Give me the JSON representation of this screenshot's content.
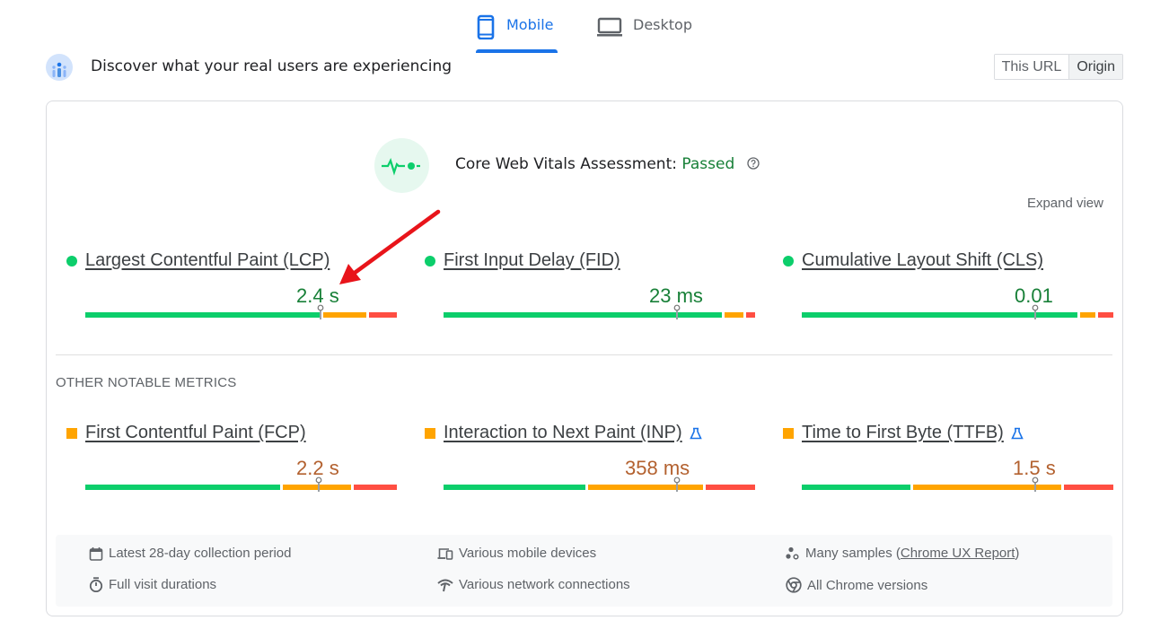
{
  "tabs": [
    {
      "label": "Mobile",
      "icon": "smartphone-icon",
      "active": true
    },
    {
      "label": "Desktop",
      "icon": "laptop-icon",
      "active": false
    }
  ],
  "header": {
    "title": "Discover what your real users are experiencing",
    "toggle": {
      "this_url": "This URL",
      "origin": "Origin",
      "selected": "Origin"
    }
  },
  "assessment": {
    "label": "Core Web Vitals Assessment:",
    "status": "Passed",
    "status_color": "#188038",
    "expand_label": "Expand view"
  },
  "core_metrics": [
    {
      "name": "Largest Contentful Paint (LCP)",
      "value": "2.4 s",
      "rating": "good",
      "distribution": {
        "good": 0.76,
        "needs_improvement": 0.14,
        "poor": 0.09
      },
      "marker": 0.755
    },
    {
      "name": "First Input Delay (FID)",
      "value": "23 ms",
      "rating": "good",
      "distribution": {
        "good": 0.9,
        "needs_improvement": 0.06,
        "poor": 0.03
      },
      "marker": 0.75
    },
    {
      "name": "Cumulative Layout Shift (CLS)",
      "value": "0.01",
      "rating": "good",
      "distribution": {
        "good": 0.89,
        "needs_improvement": 0.05,
        "poor": 0.05
      },
      "marker": 0.75
    }
  ],
  "other_section_label": "OTHER NOTABLE METRICS",
  "other_metrics": [
    {
      "name": "First Contentful Paint (FCP)",
      "value": "2.2 s",
      "rating": "average",
      "experimental": false,
      "distribution": {
        "good": 0.63,
        "needs_improvement": 0.22,
        "poor": 0.14
      },
      "marker": 0.75
    },
    {
      "name": "Interaction to Next Paint (INP)",
      "value": "358 ms",
      "rating": "average",
      "experimental": true,
      "distribution": {
        "good": 0.46,
        "needs_improvement": 0.37,
        "poor": 0.16
      },
      "marker": 0.75
    },
    {
      "name": "Time to First Byte (TTFB)",
      "value": "1.5 s",
      "rating": "average",
      "experimental": true,
      "distribution": {
        "good": 0.35,
        "needs_improvement": 0.48,
        "poor": 0.16
      },
      "marker": 0.75
    }
  ],
  "info": [
    {
      "icon": "calendar-icon",
      "text": "Latest 28-day collection period"
    },
    {
      "icon": "devices-icon",
      "text": "Various mobile devices"
    },
    {
      "icon": "samples-icon",
      "text": "Many samples (",
      "link": "Chrome UX Report",
      "suffix": ")"
    },
    {
      "icon": "timer-icon",
      "text": "Full visit durations"
    },
    {
      "icon": "network-icon",
      "text": "Various network connections"
    },
    {
      "icon": "chrome-icon",
      "text": "All Chrome versions"
    }
  ],
  "colors": {
    "good": "#0cce6b",
    "average": "#ffa400",
    "poor": "#ff4e42",
    "accent": "#1a73e8",
    "annotation_arrow": "#e8141a"
  }
}
